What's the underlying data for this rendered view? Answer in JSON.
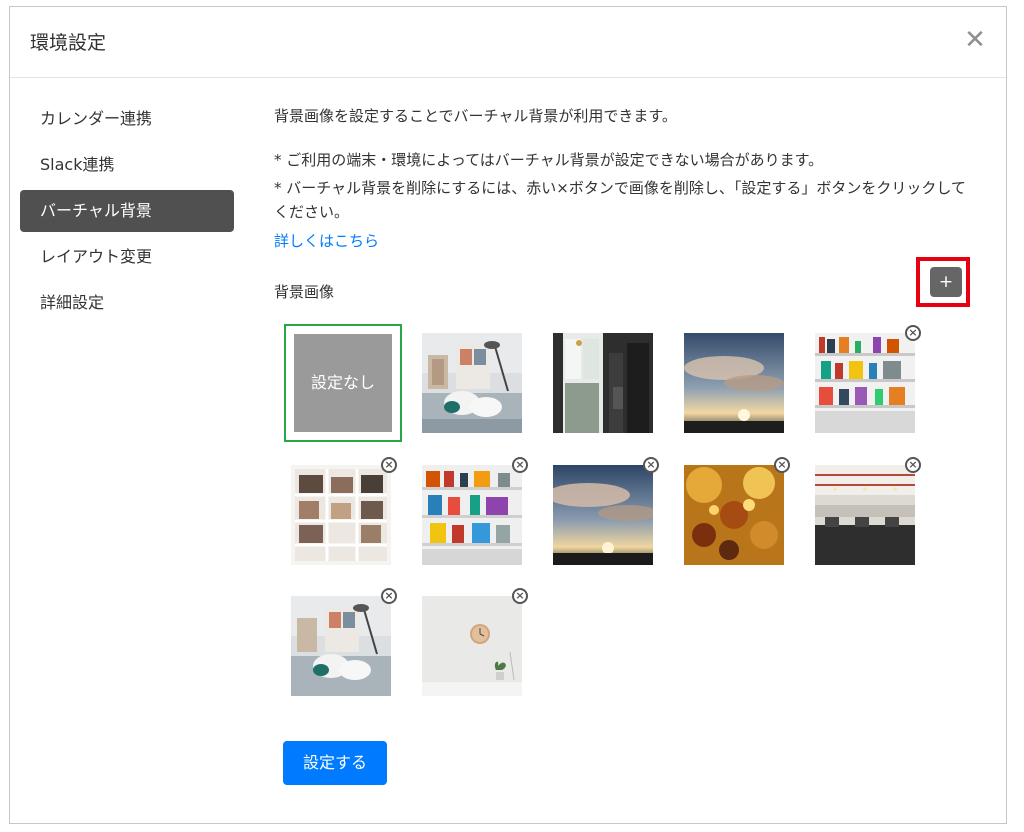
{
  "modal": {
    "title": "環境設定",
    "close_label": "✕"
  },
  "sidebar": {
    "items": [
      {
        "label": "カレンダー連携",
        "active": false
      },
      {
        "label": "Slack連携",
        "active": false
      },
      {
        "label": "バーチャル背景",
        "active": true
      },
      {
        "label": "レイアウト変更",
        "active": false
      },
      {
        "label": "詳細設定",
        "active": false
      }
    ]
  },
  "content": {
    "description": "背景画像を設定することでバーチャル背景が利用できます。",
    "notes": [
      "* ご利用の端末・環境によってはバーチャル背景が設定できない場合があります。",
      "* バーチャル背景を削除にするには、赤い×ボタンで画像を削除し、「設定する」ボタンをクリックしてください。"
    ],
    "details_link": "詳しくはこちら",
    "section_label": "背景画像",
    "add_label": "+"
  },
  "backgrounds": {
    "none_label": "設定なし",
    "delete_label": "×",
    "images": [
      "living-room-chairs",
      "cafe-window",
      "sunset-clouds",
      "bookshelf-colorful",
      "bookshelf-white",
      "bookshelf-colorful-2",
      "sunset-clouds-2",
      "autumn-leaves",
      "open-office",
      "living-room-chairs-2",
      "wall-clock-plant"
    ]
  },
  "footer": {
    "submit_label": "設定する"
  },
  "colors": {
    "accent": "#007bff",
    "selected_border": "#28a745",
    "highlight": "#e60012",
    "sidebar_active": "#505050"
  }
}
